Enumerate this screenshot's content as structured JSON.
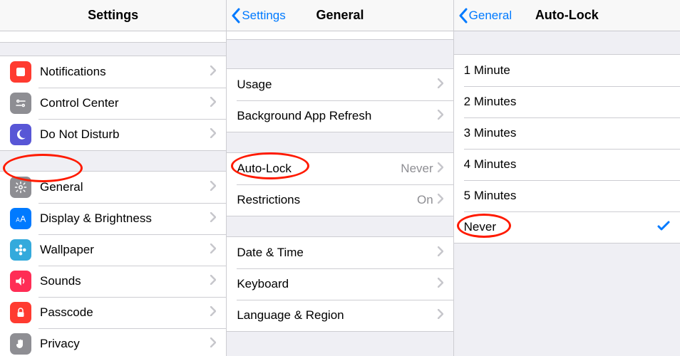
{
  "screens": {
    "settings": {
      "title": "Settings",
      "group1": [
        {
          "label": "Notifications"
        },
        {
          "label": "Control Center"
        },
        {
          "label": "Do Not Disturb"
        }
      ],
      "group2": [
        {
          "label": "General"
        },
        {
          "label": "Display & Brightness"
        },
        {
          "label": "Wallpaper"
        },
        {
          "label": "Sounds"
        },
        {
          "label": "Passcode"
        },
        {
          "label": "Privacy"
        }
      ]
    },
    "general": {
      "back": "Settings",
      "title": "General",
      "group1": [
        {
          "label": "Usage"
        },
        {
          "label": "Background App Refresh"
        }
      ],
      "group2": [
        {
          "label": "Auto-Lock",
          "value": "Never"
        },
        {
          "label": "Restrictions",
          "value": "On"
        }
      ],
      "group3": [
        {
          "label": "Date & Time"
        },
        {
          "label": "Keyboard"
        },
        {
          "label": "Language & Region"
        }
      ]
    },
    "autolock": {
      "back": "General",
      "title": "Auto-Lock",
      "options": [
        {
          "label": "1 Minute"
        },
        {
          "label": "2 Minutes"
        },
        {
          "label": "3 Minutes"
        },
        {
          "label": "4 Minutes"
        },
        {
          "label": "5 Minutes"
        },
        {
          "label": "Never",
          "selected": true
        }
      ]
    }
  }
}
